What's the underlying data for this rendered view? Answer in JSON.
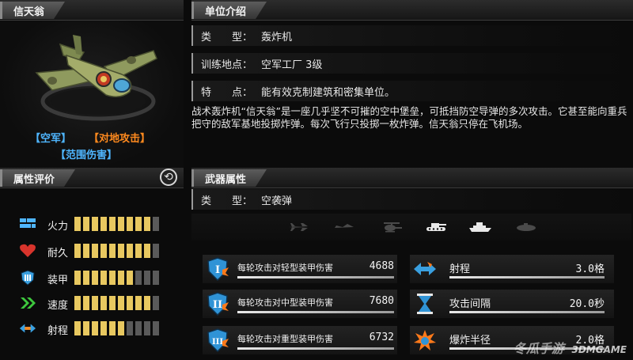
{
  "unit_name": "信天翁",
  "sections": {
    "intro": "单位介绍",
    "attributes": "属性评价",
    "weapon": "武器属性"
  },
  "info": {
    "type_key": "类　　型：",
    "type_val": "轰炸机",
    "train_key": "训练地点：",
    "train_val": "空军工厂 3级",
    "trait_key": "特　　点：",
    "trait_val": "能有效克制建筑和密集单位。"
  },
  "description": "战术轰炸机“信天翁”是一座几乎坚不可摧的空中堡垒，可抵挡防空导弹的多次攻击。它甚至能向重兵把守的敌军基地投掷炸弹。每次飞行只投掷一枚炸弹。信天翁只停在飞机场。",
  "tags": {
    "air": "【空军】",
    "ground_attack": "【对地攻击】",
    "splash": "【范围伤害】"
  },
  "attributes": [
    {
      "label": "火力",
      "icon": "firepower-icon",
      "level": 9,
      "max": 10
    },
    {
      "label": "耐久",
      "icon": "heart-icon",
      "level": 9,
      "max": 10
    },
    {
      "label": "装甲",
      "icon": "armor-icon",
      "level": 7,
      "max": 10
    },
    {
      "label": "速度",
      "icon": "speed-icon",
      "level": 9,
      "max": 10
    },
    {
      "label": "射程",
      "icon": "range-icon",
      "level": 6,
      "max": 10
    }
  ],
  "weapon": {
    "type_key": "类　　型：",
    "type_val": "空袭弹",
    "targets": [
      {
        "name": "jet-icon",
        "active": false
      },
      {
        "name": "fighter-icon",
        "active": false
      },
      {
        "name": "helicopter-icon",
        "active": false
      },
      {
        "name": "tank-icon",
        "active": true
      },
      {
        "name": "ship-icon",
        "active": true
      },
      {
        "name": "submarine-icon",
        "active": false
      }
    ]
  },
  "damage": [
    {
      "label": "每轮攻击对轻型装甲伤害",
      "value": "4688",
      "icon": "armor-light-icon",
      "numeral": "I"
    },
    {
      "label": "每轮攻击对中型装甲伤害",
      "value": "7680",
      "icon": "armor-medium-icon",
      "numeral": "II"
    },
    {
      "label": "每轮攻击对重型装甲伤害",
      "value": "6732",
      "icon": "armor-heavy-icon",
      "numeral": "III"
    }
  ],
  "stats": [
    {
      "label": "射程",
      "value": "3.0格",
      "icon": "range-arrow-icon"
    },
    {
      "label": "攻击间隔",
      "value": "20.0秒",
      "icon": "hourglass-icon"
    },
    {
      "label": "爆炸半径",
      "value": "2.0格",
      "icon": "explosion-icon"
    }
  ],
  "watermark": {
    "brand": "冬瓜手游",
    "url": "3DMGAME"
  },
  "colors": {
    "tag_blue": "#4fb6ff",
    "tag_orange": "#ff8a1e",
    "bar_on": "#e8c860",
    "bar_off": "#5a5a5a"
  }
}
